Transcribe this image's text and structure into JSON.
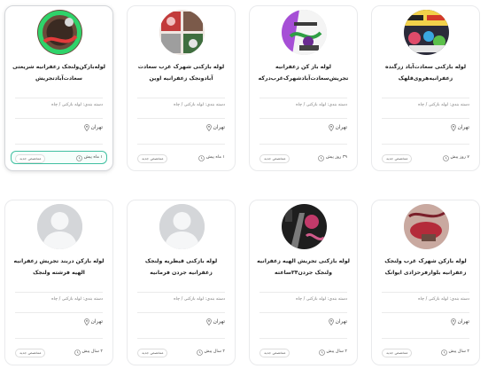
{
  "cards": [
    {
      "title": "لوله بازکن شهرک غرب ولنجک زعفرانیه بلوارفرحزادی ایوانک",
      "category": "دسته بندی: لوله بازکنی / چاه",
      "city": "تهران",
      "time": "۲ سال پیش",
      "badge": "متخصص جدید",
      "photo_palette": "pink-crimson"
    },
    {
      "title": "لوله بازکنی تجریش الهیه زعفرانیه ولنجک جردن۲۴ساعته",
      "category": "دسته بندی: لوله بازکنی / چاه",
      "city": "تهران",
      "time": "۲ سال پیش",
      "badge": "متخصص جدید",
      "photo_palette": "black-pink-tool"
    },
    {
      "title": "لوله بازکنی قیطریه ولنجک زعفرانیه جردن فرمانیه",
      "category": "دسته بندی: لوله بازکنی / چاه",
      "city": "تهران",
      "time": "۲ سال پیش",
      "badge": "متخصص جدید",
      "photo_palette": "default-avatar"
    },
    {
      "title": "لوله بازکن دربند تجریش زعفرانیه الهیه فرشته ولنجک",
      "category": "دسته بندی: لوله بازکنی / چاه",
      "city": "تهران",
      "time": "۲ سال پیش",
      "badge": "متخصص جدید",
      "photo_palette": "default-avatar"
    },
    {
      "title": "لوله بازکنی سعادت‌آباد زرگنده زعفرانیه‌هروی‌قلهک",
      "category": "دسته بندی: لوله بازکنی / چاه",
      "city": "تهران",
      "time": "۷ روز پیش",
      "badge": "متخصص جدید",
      "photo_palette": "multicolor-sign"
    },
    {
      "title": "لوله باز کن زعفرانیه تجریش‌سعادت‌آباد‌شهرک‌غرب‌درکه",
      "category": "دسته بندی: لوله بازکنی / چاه",
      "city": "تهران",
      "time": "۳۹ روز پیش",
      "badge": "متخصص جدید",
      "photo_palette": "purple-green"
    },
    {
      "title": "لوله بازکنی شهرک غرب سعادت آبادونجک زعفرانیه اوین",
      "category": "دسته بندی: لوله بازکنی / چاه",
      "city": "تهران",
      "time": "۱ ماه پیش",
      "badge": "متخصص جدید",
      "photo_palette": "red-grid"
    },
    {
      "title": "لوله‌بازکن‌ولنجک زعفرانیه شریعتی سعادت‌آبادتجریش",
      "category": "دسته بندی: لوله بازکنی / چاه",
      "city": "تهران",
      "time": "۱ ماه پیش",
      "badge": "متخصص جدید",
      "photo_palette": "green-ring-red"
    }
  ]
}
